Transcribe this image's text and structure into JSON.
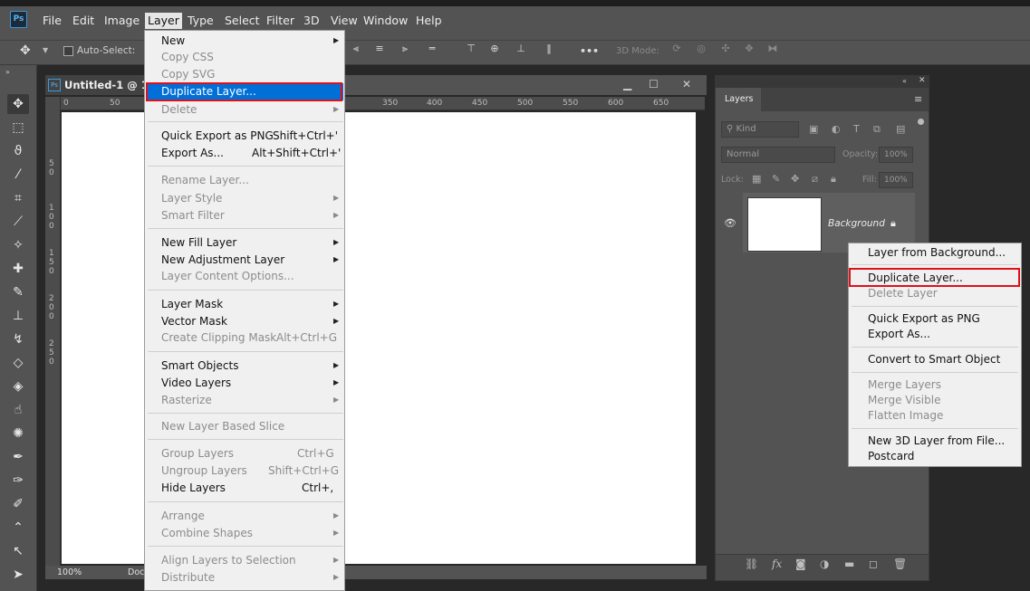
{
  "app": {
    "logo": "Ps"
  },
  "menubar": {
    "file": "File",
    "edit": "Edit",
    "image": "Image",
    "layer": "Layer",
    "type": "Type",
    "select": "Select",
    "filter": "Filter",
    "three_d": "3D",
    "view": "View",
    "window": "Window",
    "help": "Help"
  },
  "options_bar": {
    "auto_select": "Auto-Select:",
    "three_d_mode": "3D Mode:",
    "more": "•••"
  },
  "document": {
    "title": "Untitled-1 @ 100",
    "zoom": "100%",
    "doc_label": "Doc",
    "ruler_top": [
      "0",
      "50",
      "350",
      "400",
      "450",
      "500",
      "550",
      "600",
      "650"
    ],
    "ruler_left": [
      "5\n0",
      "1\n0\n0",
      "1\n5\n0",
      "2\n0\n0",
      "2\n5\n0"
    ]
  },
  "layer_menu": {
    "new": "New",
    "copy_css": "Copy CSS",
    "copy_svg": "Copy SVG",
    "duplicate_layer": "Duplicate Layer...",
    "delete": "Delete",
    "quick_export": "Quick Export as PNG",
    "quick_export_sc": "Shift+Ctrl+'",
    "export_as": "Export As...",
    "export_as_sc": "Alt+Shift+Ctrl+'",
    "rename_layer": "Rename Layer...",
    "layer_style": "Layer Style",
    "smart_filter": "Smart Filter",
    "new_fill_layer": "New Fill Layer",
    "new_adjustment_layer": "New Adjustment Layer",
    "layer_content_options": "Layer Content Options...",
    "layer_mask": "Layer Mask",
    "vector_mask": "Vector Mask",
    "create_clipping_mask": "Create Clipping Mask",
    "create_clipping_mask_sc": "Alt+Ctrl+G",
    "smart_objects": "Smart Objects",
    "video_layers": "Video Layers",
    "rasterize": "Rasterize",
    "new_layer_based_slice": "New Layer Based Slice",
    "group_layers": "Group Layers",
    "group_layers_sc": "Ctrl+G",
    "ungroup_layers": "Ungroup Layers",
    "ungroup_layers_sc": "Shift+Ctrl+G",
    "hide_layers": "Hide Layers",
    "hide_layers_sc": "Ctrl+,",
    "arrange": "Arrange",
    "combine_shapes": "Combine Shapes",
    "align_layers": "Align Layers to Selection",
    "distribute": "Distribute"
  },
  "layers_panel": {
    "tab": "Layers",
    "kind": "Kind",
    "blend_mode": "Normal",
    "opacity_label": "Opacity:",
    "opacity_value": "100%",
    "lock_label": "Lock:",
    "fill_label": "Fill:",
    "fill_value": "100%",
    "layer_name": "Background"
  },
  "context_menu": {
    "layer_from_background": "Layer from Background...",
    "duplicate_layer": "Duplicate Layer...",
    "delete_layer": "Delete Layer",
    "quick_export": "Quick Export as PNG",
    "export_as": "Export As...",
    "convert_smart": "Convert to Smart Object",
    "merge_layers": "Merge Layers",
    "merge_visible": "Merge Visible",
    "flatten_image": "Flatten Image",
    "new_3d_layer": "New 3D Layer from File...",
    "postcard": "Postcard"
  },
  "colors": {
    "highlight": "#0070d8",
    "callout": "#e0101a",
    "panel": "#535353"
  }
}
